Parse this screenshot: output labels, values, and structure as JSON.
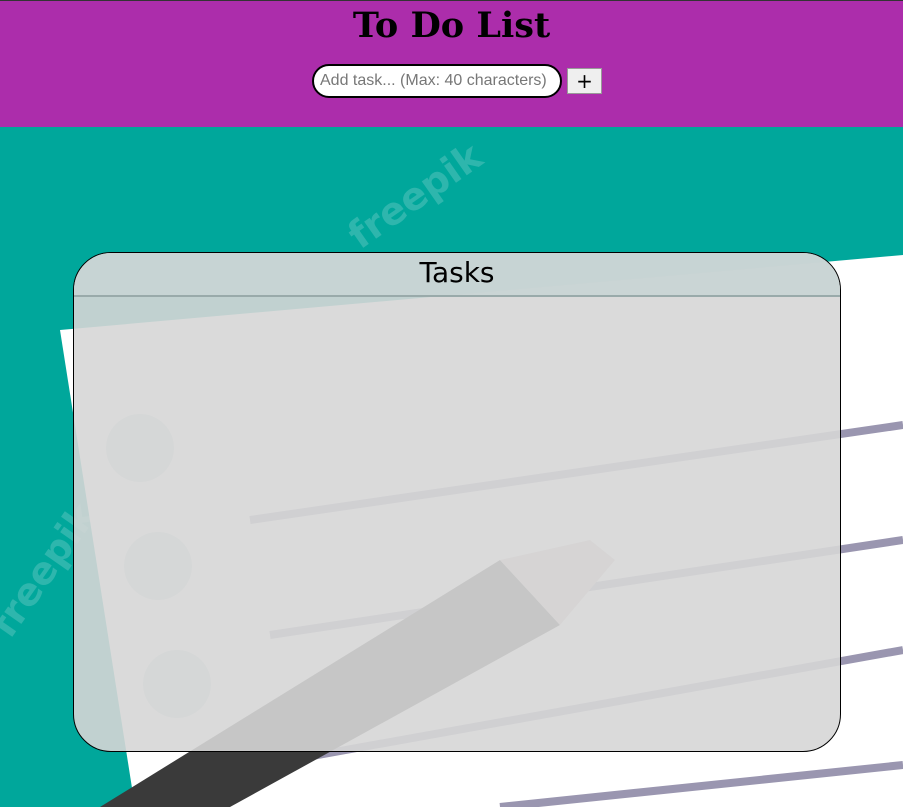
{
  "header": {
    "title": "To Do List",
    "input_placeholder": "Add task... (Max: 40 characters)",
    "add_label": "+"
  },
  "tasks": {
    "title": "Tasks",
    "items": []
  },
  "colors": {
    "header_bg": "#ac2dab",
    "page_bg": "#00a79b",
    "panel_bg": "#d6d6d6"
  }
}
